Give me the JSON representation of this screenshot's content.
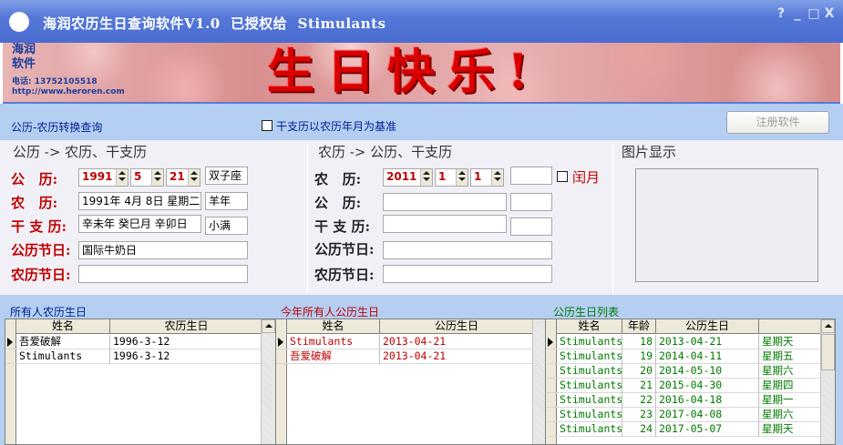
{
  "window": {
    "title": "海润农历生日查询软件V1.0  已授权给  Stimulants",
    "buttons": [
      "?",
      "_",
      "□",
      "X"
    ]
  },
  "banner": {
    "logo_name": "海润软件",
    "phone": "电话: 13752105518",
    "url": "http://www.heroren.com",
    "title": "生日快乐!"
  },
  "toolbar": {
    "label": "公历-农历转换查询",
    "ganzhi_checkbox_label": "干支历以农历年月为基准",
    "ganzhi_checked": false,
    "register_button": "注册软件"
  },
  "solar_section": {
    "title": "公历 -> 农历、干支历",
    "label_solar": "公   历:",
    "label_lunar": "农   历:",
    "label_ganzhi": "干 支 历:",
    "label_solar_festival": "公历节日:",
    "label_lunar_festival": "农历节日:",
    "year": "1991",
    "month": "5",
    "day": "21",
    "zodiac_sign": "双子座",
    "lunar_value": "1991年 4月 8日 星期二",
    "lunar_animal": "羊年",
    "ganzhi_value": "辛未年 癸巳月 辛卯日",
    "solar_term": "小满",
    "solar_festival": "国际牛奶日",
    "lunar_festival": ""
  },
  "lunar_section": {
    "title": "农历 -> 公历、干支历",
    "label_lunar": "农   历:",
    "label_solar": "公   历:",
    "label_ganzhi": "干 支 历:",
    "label_solar_festival": "公历节日:",
    "label_lunar_festival": "农历节日:",
    "year": "2011",
    "month": "1",
    "day": "1",
    "leap_label": "闰月",
    "leap_checked": false
  },
  "picture_section": {
    "title": "图片显示"
  },
  "grid_lunar": {
    "title": "所有人农历生日",
    "title_color": "#00208f",
    "headers": [
      "姓名",
      "农历生日"
    ],
    "rows": [
      [
        "吾爱破解",
        "1996-3-12"
      ],
      [
        "Stimulants",
        "1996-3-12"
      ]
    ]
  },
  "grid_this_year": {
    "title": "今年所有人公历生日",
    "title_color": "#c00000",
    "headers": [
      "姓名",
      "公历生日"
    ],
    "rows": [
      [
        "Stimulants",
        "2013-04-21"
      ],
      [
        "吾爱破解",
        "2013-04-21"
      ]
    ]
  },
  "grid_list": {
    "title": "公历生日列表",
    "title_color": "#007a00",
    "headers": [
      "姓名",
      "年龄",
      "公历生日",
      ""
    ],
    "rows": [
      [
        "Stimulants",
        "18",
        "2013-04-21",
        "星期天"
      ],
      [
        "Stimulants",
        "19",
        "2014-04-11",
        "星期五"
      ],
      [
        "Stimulants",
        "20",
        "2014-05-10",
        "星期六"
      ],
      [
        "Stimulants",
        "21",
        "2015-04-30",
        "星期四"
      ],
      [
        "Stimulants",
        "22",
        "2016-04-18",
        "星期一"
      ],
      [
        "Stimulants",
        "23",
        "2017-04-08",
        "星期六"
      ],
      [
        "Stimulants",
        "24",
        "2017-05-07",
        "星期天"
      ]
    ]
  }
}
